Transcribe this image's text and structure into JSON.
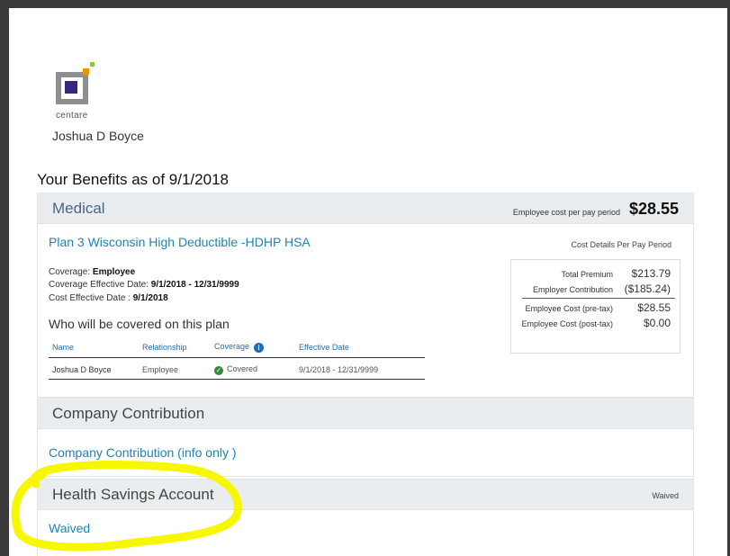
{
  "logo": {
    "text": "centare"
  },
  "user": {
    "name": "Joshua D Boyce"
  },
  "benefits_title": "Your Benefits as of 9/1/2018",
  "medical": {
    "title": "Medical",
    "employee_cost_label": "Employee cost per pay period",
    "employee_cost_value": "$28.55",
    "plan_name": "Plan 3 Wisconsin High Deductible -HDHP HSA",
    "cost_details_label": "Cost Details Per Pay Period",
    "coverage_label": "Coverage:",
    "coverage_value": "Employee",
    "coverage_effective_label": "Coverage Effective Date:",
    "coverage_effective_value": "9/1/2018 - 12/31/9999",
    "cost_effective_label": "Cost Effective Date :",
    "cost_effective_value": "9/1/2018",
    "who_heading": "Who will be covered on this plan",
    "table": {
      "headers": [
        "Name",
        "Relationship",
        "Coverage",
        "Effective Date"
      ],
      "rows": [
        {
          "name": "Joshua D Boyce",
          "relationship": "Employee",
          "coverage": "Covered",
          "effective": "9/1/2018 - 12/31/9999"
        }
      ]
    },
    "costs": {
      "total_premium_label": "Total Premium",
      "total_premium_value": "$213.79",
      "employer_contribution_label": "Employer Contribution",
      "employer_contribution_value": "($185.24)",
      "pre_tax_label": "Employee Cost (pre-tax)",
      "pre_tax_value": "$28.55",
      "post_tax_label": "Employee Cost (post-tax)",
      "post_tax_value": "$0.00"
    }
  },
  "company_contribution": {
    "title": "Company Contribution",
    "link": "Company Contribution (info only )"
  },
  "hsa": {
    "title": "Health Savings Account",
    "status": "Waived",
    "link": "Waived"
  },
  "colors": {
    "link": "#1a86b5",
    "header_bg": "#eaedef",
    "highlight": "#f7f700",
    "covered_check": "#2e8b3a",
    "info_icon": "#1f6eb5"
  }
}
